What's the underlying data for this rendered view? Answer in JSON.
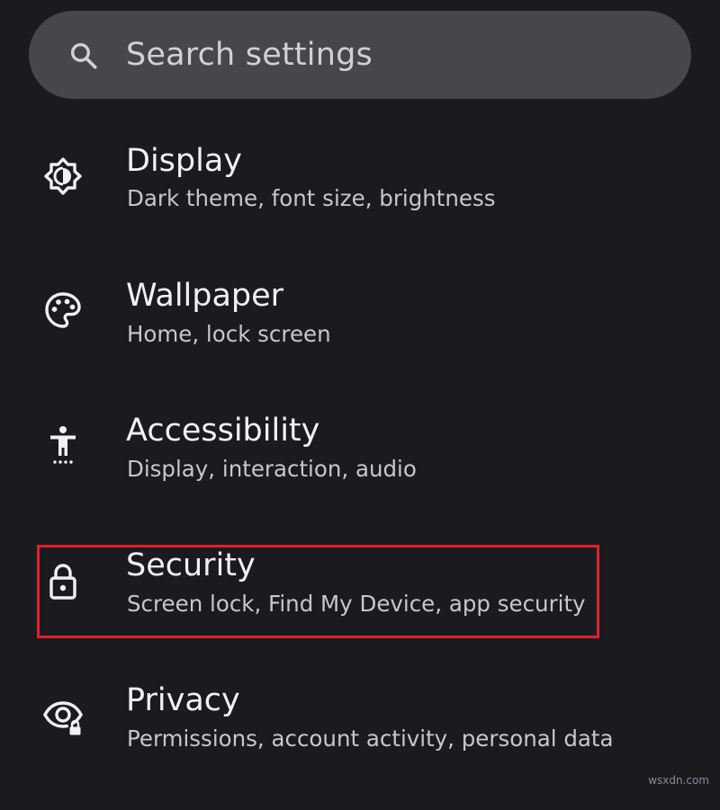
{
  "search": {
    "placeholder": "Search settings"
  },
  "items": [
    {
      "title": "Display",
      "subtitle": "Dark theme, font size, brightness",
      "icon": "brightness-icon"
    },
    {
      "title": "Wallpaper",
      "subtitle": "Home, lock screen",
      "icon": "palette-icon"
    },
    {
      "title": "Accessibility",
      "subtitle": "Display, interaction, audio",
      "icon": "accessibility-icon"
    },
    {
      "title": "Security",
      "subtitle": "Screen lock, Find My Device, app security",
      "icon": "lock-icon"
    },
    {
      "title": "Privacy",
      "subtitle": "Permissions, account activity, personal data",
      "icon": "privacy-eye-icon"
    }
  ],
  "highlight": {
    "target": "Security",
    "color": "#e0202a"
  },
  "watermark": "wsxdn.com",
  "colors": {
    "background": "#1b1b1f",
    "search_bg": "#46474b",
    "title": "#f3eff4",
    "subtitle": "#c9c5cc"
  }
}
